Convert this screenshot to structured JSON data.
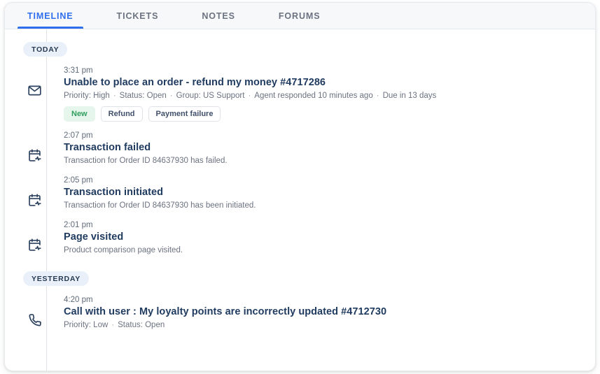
{
  "tabs": [
    {
      "label": "TIMELINE",
      "active": true
    },
    {
      "label": "TICKETS",
      "active": false
    },
    {
      "label": "NOTES",
      "active": false
    },
    {
      "label": "FORUMS",
      "active": false
    }
  ],
  "groups": [
    {
      "day_label": "TODAY",
      "entries": [
        {
          "time": "3:31 pm",
          "icon": "envelope-icon",
          "title": "Unable to place an order - refund my money #4717286",
          "meta": [
            "Priority: High",
            "Status: Open",
            "Group: US Support",
            "Agent responded 10 minutes ago",
            "Due in 13 days"
          ],
          "tags": [
            {
              "label": "New",
              "style": "green"
            },
            {
              "label": "Refund",
              "style": "plain"
            },
            {
              "label": "Payment failure",
              "style": "plain"
            }
          ]
        },
        {
          "time": "2:07 pm",
          "icon": "calendar-activity-icon",
          "title": "Transaction failed",
          "meta": [
            "Transaction for Order ID 84637930 has failed."
          ],
          "tags": []
        },
        {
          "time": "2:05 pm",
          "icon": "calendar-activity-icon",
          "title": "Transaction initiated",
          "meta": [
            "Transaction for Order ID 84637930 has been initiated."
          ],
          "tags": []
        },
        {
          "time": "2:01 pm",
          "icon": "calendar-activity-icon",
          "title": "Page visited",
          "meta": [
            "Product comparison page visited."
          ],
          "tags": []
        }
      ]
    },
    {
      "day_label": "YESTERDAY",
      "entries": [
        {
          "time": "4:20 pm",
          "icon": "phone-icon",
          "title": "Call with user : My loyalty points are incorrectly updated #4712730",
          "meta": [
            "Priority: Low",
            "Status: Open"
          ],
          "tags": []
        }
      ]
    }
  ],
  "colors": {
    "accent": "#2f6fed",
    "title": "#1f3a5f",
    "meta": "#6b7280",
    "tag_green_bg": "#e6f6ec",
    "tag_green_text": "#2f9e5d",
    "pill_bg": "#eaf0f9",
    "rail": "#dfe3e8"
  }
}
